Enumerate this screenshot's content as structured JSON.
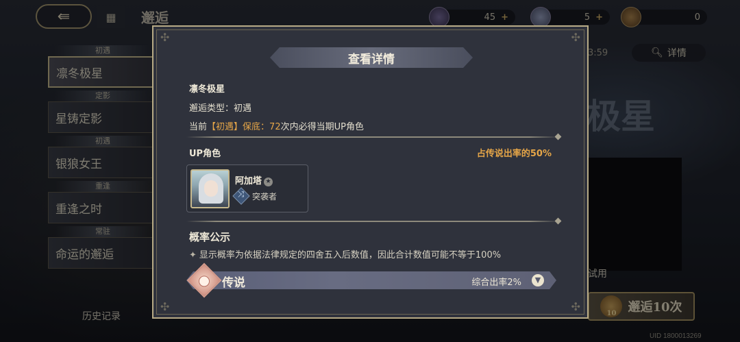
{
  "topbar": {
    "back_icon": "arrow-left-icon",
    "menu_icon": "grid-icon",
    "title": "邂逅",
    "currencies": [
      {
        "icon": "gem-icon",
        "value": "45",
        "plus": "+"
      },
      {
        "icon": "ticket-icon",
        "value": "5",
        "plus": "+"
      },
      {
        "icon": "coin-icon",
        "value": "0"
      }
    ]
  },
  "banners": [
    {
      "tag": "初遇",
      "name": "凛冬极星"
    },
    {
      "tag": "定影",
      "name": "星铸定影"
    },
    {
      "tag": "初遇",
      "name": "银狼女王"
    },
    {
      "tag": "重逢",
      "name": "重逢之时"
    },
    {
      "tag": "常驻",
      "name": "命运的邂逅"
    }
  ],
  "history_label": "历史记录",
  "right_panel": {
    "time_partial": "3:59",
    "detail_label": "详情",
    "big_title_partial": "极星",
    "trial_label_partial": "试用",
    "summon_label": "邂逅10次",
    "summon_cost": "10",
    "uid": "UID 1800013269"
  },
  "dialog": {
    "title": "查看详情",
    "banner_name": "凛冬极星",
    "type_label": "邂逅类型：初遇",
    "pity_prefix": "当前",
    "pity_tag": "【初遇】保底",
    "pity_colon": "：",
    "pity_count": "72",
    "pity_suffix": "次内必得当期UP角色",
    "up_title": "UP角色",
    "up_rate": "占传说出率的50%",
    "character": {
      "name": "阿加塔",
      "star_icon": "star-badge-icon",
      "class_icon": "assault-class-icon",
      "class_name": "突袭者"
    },
    "prob_title": "概率公示",
    "prob_note": "显示概率为依据法律规定的四舍五入后数值，因此合计数值可能不等于100%",
    "rarity": {
      "name": "传说",
      "rate_text": "综合出率2%"
    }
  },
  "colors": {
    "accent_orange": "#e6a648",
    "dialog_bg": "#2f323c",
    "border_gold": "#b8ab86"
  }
}
